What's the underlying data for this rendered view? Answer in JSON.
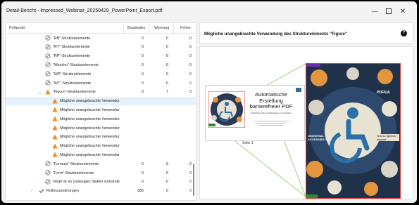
{
  "window": {
    "title": "Detail-Bericht - Impressed_Webinar_20250429_PowerPoint_Export.pdf",
    "controls": [
      "minimize-icon",
      "maximize-icon",
      "close-icon"
    ]
  },
  "table": {
    "headers": {
      "name": "Prüfpunkt",
      "passed": "Bestanden",
      "warning": "Warnung",
      "error": "Fehler"
    },
    "rows": [
      {
        "label": "\"RB\"-Strukturelemente",
        "passed": "0",
        "warning": "0",
        "error": "0",
        "icon": "check-circle-icon"
      },
      {
        "label": "\"RT\"-Strukturelemente",
        "passed": "0",
        "warning": "0",
        "error": "0",
        "icon": "check-circle-icon"
      },
      {
        "label": "\"RP\"-Strukturelemente",
        "passed": "0",
        "warning": "0",
        "error": "0",
        "icon": "check-circle-icon"
      },
      {
        "label": "\"Warichu\"-Strukturelemente",
        "passed": "0",
        "warning": "0",
        "error": "0",
        "icon": "check-circle-icon"
      },
      {
        "label": "\"WP\"-Strukturelemente",
        "passed": "0",
        "warning": "0",
        "error": "0",
        "icon": "check-circle-icon"
      },
      {
        "label": "\"WT\"-Strukturelemente",
        "passed": "0",
        "warning": "0",
        "error": "0",
        "icon": "check-circle-icon"
      },
      {
        "label": "\"Figure\"-Strukturelemente",
        "passed": "0",
        "warning": "7",
        "error": "0",
        "icon": "warning-icon"
      },
      {
        "label": "Mögliche unangebrachte Verwendung ...",
        "passed": "",
        "warning": "",
        "error": "",
        "icon": "warning-icon"
      },
      {
        "label": "Mögliche unangebrachte Verwendung ...",
        "passed": "",
        "warning": "",
        "error": "",
        "icon": "warning-icon"
      },
      {
        "label": "Mögliche unangebrachte Verwendung ...",
        "passed": "",
        "warning": "",
        "error": "",
        "icon": "warning-icon"
      },
      {
        "label": "Mögliche unangebrachte Verwendung ...",
        "passed": "",
        "warning": "",
        "error": "",
        "icon": "warning-icon"
      },
      {
        "label": "Mögliche unangebrachte Verwendung ...",
        "passed": "",
        "warning": "",
        "error": "",
        "icon": "warning-icon"
      },
      {
        "label": "Mögliche unangebrachte Verwendung ...",
        "passed": "",
        "warning": "",
        "error": "",
        "icon": "warning-icon"
      },
      {
        "label": "Mögliche unangebrachte Verwendung ...",
        "passed": "",
        "warning": "",
        "error": "",
        "icon": "warning-icon"
      },
      {
        "label": "\"Formula\"-Strukturelemente",
        "passed": "0",
        "warning": "0",
        "error": "0",
        "icon": "check-circle-icon"
      },
      {
        "label": "\"Form\"-Strukturelemente",
        "passed": "0",
        "warning": "0",
        "error": "0",
        "icon": "check-circle-icon"
      },
      {
        "label": "Inhalt ist an zulässigen Stellen vorhanden",
        "passed": "0",
        "warning": "0",
        "error": "0",
        "icon": "check-circle-icon"
      },
      {
        "label": "Rollenzuordnungen",
        "passed": "385",
        "warning": "0",
        "error": "0",
        "icon": "checkmark-icon"
      }
    ]
  },
  "detail": {
    "title": "Mögliche unangebrachte Verwendung des Strukturelements \"Figure\"",
    "help": "?"
  },
  "preview": {
    "slide_title": "Automatische Erstellung barrierefreier PDF",
    "slide_subtitle": "Mit Webinar, Rolle und Bearbeitung in PowerPoint",
    "slide_caption": "Seite 1",
    "zoom_labels": {
      "top_right": "PDF/UA",
      "universal": "UNIVERSAL ACCESSIBILITY",
      "text_to_speech": "Text-to-Speech support"
    }
  },
  "colors": {
    "warning": "#f08a24",
    "ok": "#6b6b6b",
    "check": "#2e8b2e",
    "selection": "#e5f1fb",
    "highlight_border": "#e0332f",
    "connector": "#9bd47a"
  }
}
